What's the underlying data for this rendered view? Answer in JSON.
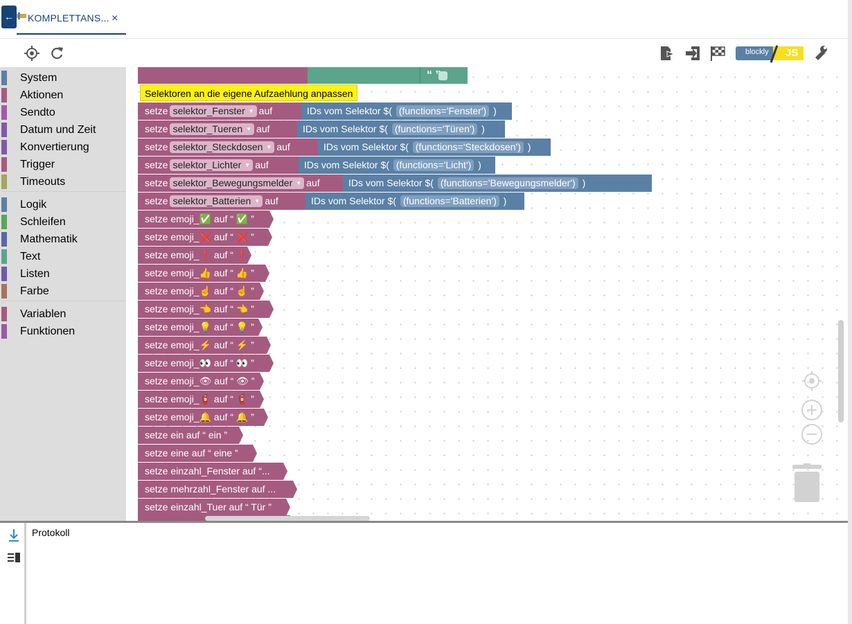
{
  "tab": {
    "title": "KOMPLETTANS...",
    "close": "×",
    "back": "←"
  },
  "toolbar": {
    "blockly_label": "blockly",
    "js_label": "JS"
  },
  "categories": [
    {
      "label": "System",
      "color": "#5b80a5"
    },
    {
      "label": "Aktionen",
      "color": "#a55b80"
    },
    {
      "label": "Sendto",
      "color": "#a55ba5"
    },
    {
      "label": "Datum und Zeit",
      "color": "#805ba5"
    },
    {
      "label": "Konvertierung",
      "color": "#805ba5"
    },
    {
      "label": "Trigger",
      "color": "#a55b80"
    },
    {
      "label": "Timeouts",
      "color": "#a5a55b"
    },
    {
      "label": "Logik",
      "color": "#5b80a5"
    },
    {
      "label": "Schleifen",
      "color": "#5ba55b"
    },
    {
      "label": "Mathematik",
      "color": "#5b67a5"
    },
    {
      "label": "Text",
      "color": "#5ba58c"
    },
    {
      "label": "Listen",
      "color": "#745ba5"
    },
    {
      "label": "Farbe",
      "color": "#a5745b"
    },
    {
      "label": "Variablen",
      "color": "#a55b80"
    },
    {
      "label": "Funktionen",
      "color": "#995ba5"
    }
  ],
  "workspace": {
    "top_string": "“ ”",
    "comment": "Selektoren an die eigene Aufzaehlung anpassen",
    "setze": "setze",
    "auf": "auf",
    "selector_prefix": "IDs vom Selektor $(",
    "close_paren": ")",
    "selectors": [
      {
        "var": "selektor_Fenster",
        "expr": "(functions='Fenster')"
      },
      {
        "var": "selektor_Tueren",
        "expr": "(functions='Türen')"
      },
      {
        "var": "selektor_Steckdosen",
        "expr": "(functions='Steckdosen')"
      },
      {
        "var": "selektor_Lichter",
        "expr": "(functions='Licht')"
      },
      {
        "var": "selektor_Bewegungsmelder",
        "expr": "(functions='Bewegungsmelder')"
      },
      {
        "var": "selektor_Batterien",
        "expr": "(functions='Batterien')"
      }
    ],
    "emoji_rows": [
      {
        "prefix": "setze emoji_",
        "emoji": "✅",
        "mid": "auf “",
        "end": "”"
      },
      {
        "prefix": "setze emoji_",
        "emoji": "❌",
        "mid": "auf “",
        "end": "”"
      },
      {
        "prefix": "setze emoji_",
        "emoji": "❗",
        "mid": "auf “",
        "end": "”"
      },
      {
        "prefix": "setze emoji_",
        "emoji": "👍",
        "mid": "auf “",
        "end": "”"
      },
      {
        "prefix": "setze emoji_",
        "emoji": "☝",
        "mid": "auf “",
        "end": "”"
      },
      {
        "prefix": "setze emoji_",
        "emoji": "👈",
        "mid": "auf “",
        "end": "”"
      },
      {
        "prefix": "setze emoji_",
        "emoji": "💡",
        "mid": "auf “",
        "end": "”"
      },
      {
        "prefix": "setze emoji_",
        "emoji": "⚡",
        "mid": "auf “",
        "end": "”"
      },
      {
        "prefix": "setze emoji_",
        "emoji": "👀",
        "mid": "auf “",
        "end": "”"
      },
      {
        "prefix": "setze emoji_",
        "emoji": "👁",
        "mid": "auf “",
        "end": "”"
      },
      {
        "prefix": "setze emoji_",
        "emoji": "🧯",
        "mid": "auf “",
        "end": "”"
      },
      {
        "prefix": "setze emoji_",
        "emoji": "🔔",
        "mid": "auf “",
        "end": "”"
      }
    ],
    "text_rows": [
      "setze ein auf “ ein ”",
      "setze eine auf “ eine ”",
      "setze einzahl_Fenster auf “...",
      "setze mehrzahl_Fenster auf ...",
      "setze einzahl_Tuer auf “ Tür ”"
    ]
  },
  "log": {
    "title": "Protokoll"
  }
}
